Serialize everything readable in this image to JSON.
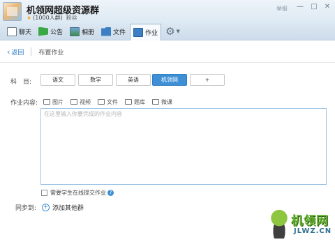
{
  "window": {
    "group_title": "机领网超级资源群",
    "member_count": "(1000人群)",
    "fans_label": "粉丝",
    "report_label": "举报",
    "controls": [
      "—",
      "□",
      "✕"
    ]
  },
  "toolbar": {
    "items": [
      {
        "label": "聊天",
        "icon": "chat-icon"
      },
      {
        "label": "公告",
        "icon": "notice-flag-icon"
      },
      {
        "label": "相册",
        "icon": "album-icon"
      },
      {
        "label": "文件",
        "icon": "folder-icon"
      },
      {
        "label": "作业",
        "icon": "homework-icon",
        "active": true
      }
    ],
    "settings_icon": "gear-icon"
  },
  "breadcrumb": {
    "back_label": "返回",
    "page_title": "布置作业"
  },
  "form": {
    "subject_label": "科　目:",
    "subjects": [
      "语文",
      "数学",
      "英语",
      "机领网",
      "+"
    ],
    "selected_subject": "机领网",
    "content_label": "作业内容:",
    "attach_tools": [
      {
        "label": "图片",
        "icon": "image-icon"
      },
      {
        "label": "视频",
        "icon": "video-icon"
      },
      {
        "label": "文件",
        "icon": "file-icon"
      },
      {
        "label": "题库",
        "icon": "question-bank-icon"
      },
      {
        "label": "微课",
        "icon": "micro-lesson-icon"
      }
    ],
    "content_placeholder": "在这里输入你要完成的作业内容",
    "online_submit_label": "需要学生在线提交作业",
    "sync_label": "同步到:",
    "add_group_label": "添加其他群"
  },
  "watermark": {
    "text": "机领网",
    "url": "JLWZ.CN"
  },
  "colors": {
    "accent": "#3e8fd6",
    "toolbar_bg": "#cddceb",
    "textarea_border": "#9cc3e5"
  }
}
